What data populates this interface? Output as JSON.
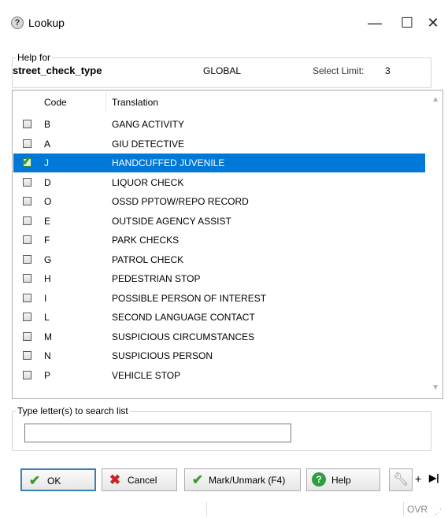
{
  "window": {
    "title": "Lookup",
    "minimize_glyph": "—",
    "maximize_glyph": "☐",
    "close_glyph": "✕"
  },
  "help_group": {
    "legend": "Help for",
    "field_name": "street_check_type",
    "scope": "GLOBAL",
    "select_limit_label": "Select Limit:",
    "select_limit_value": "3"
  },
  "list": {
    "columns": [
      "Code",
      "Translation"
    ],
    "rows": [
      {
        "code": "B",
        "translation": "GANG ACTIVITY",
        "checked": false,
        "selected": false
      },
      {
        "code": "A",
        "translation": "GIU DETECTIVE",
        "checked": false,
        "selected": false
      },
      {
        "code": "J",
        "translation": "HANDCUFFED JUVENILE",
        "checked": true,
        "selected": true
      },
      {
        "code": "D",
        "translation": "LIQUOR CHECK",
        "checked": false,
        "selected": false
      },
      {
        "code": "O",
        "translation": "OSSD PPTOW/REPO RECORD",
        "checked": false,
        "selected": false
      },
      {
        "code": "E",
        "translation": "OUTSIDE AGENCY ASSIST",
        "checked": false,
        "selected": false
      },
      {
        "code": "F",
        "translation": "PARK CHECKS",
        "checked": false,
        "selected": false
      },
      {
        "code": "G",
        "translation": "PATROL CHECK",
        "checked": false,
        "selected": false
      },
      {
        "code": "H",
        "translation": "PEDESTRIAN STOP",
        "checked": false,
        "selected": false
      },
      {
        "code": "I",
        "translation": "POSSIBLE PERSON OF INTEREST",
        "checked": false,
        "selected": false
      },
      {
        "code": "L",
        "translation": "SECOND LANGUAGE CONTACT",
        "checked": false,
        "selected": false
      },
      {
        "code": "M",
        "translation": "SUSPICIOUS CIRCUMSTANCES",
        "checked": false,
        "selected": false
      },
      {
        "code": "N",
        "translation": "SUSPICIOUS PERSON",
        "checked": false,
        "selected": false
      },
      {
        "code": "P",
        "translation": "VEHICLE STOP",
        "checked": false,
        "selected": false
      }
    ]
  },
  "search": {
    "legend": "Type letter(s) to search list",
    "value": ""
  },
  "buttons": {
    "ok": "OK",
    "cancel": "Cancel",
    "mark": "Mark/Unmark (F4)",
    "help": "Help",
    "plus": "+"
  },
  "status": {
    "ovr": "OVR"
  },
  "colors": {
    "selection": "#0078d7",
    "ok_border": "#3c7fb1",
    "check_green": "#3a9a2a",
    "cancel_red": "#cc2222",
    "help_green": "#2e9e3e"
  },
  "icons": {
    "title": "help-question-icon",
    "ok": "green-check-icon",
    "cancel": "red-x-icon",
    "mark": "check-mark-icon",
    "help": "help-circle-icon",
    "tool": "wrench-icon",
    "end": "skip-end-icon"
  }
}
